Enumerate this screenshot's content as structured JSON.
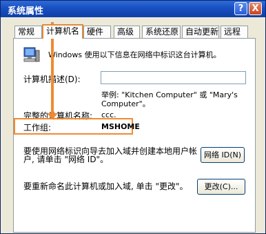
{
  "window": {
    "title": "系统属性",
    "help_button": "?",
    "close_button": "X"
  },
  "tabs": [
    {
      "label": "常规"
    },
    {
      "label": "计算机名",
      "active": true
    },
    {
      "label": "硬件"
    },
    {
      "label": "高级"
    },
    {
      "label": "系统还原"
    },
    {
      "label": "自动更新"
    },
    {
      "label": "远程"
    }
  ],
  "panel": {
    "intro": "Windows 使用以下信息在网络中标识这台计算机。",
    "description_label": "计算机描述(D):",
    "description_value": "",
    "example_line1": "举例: \"Kitchen Computer\" 或 \"Mary's",
    "example_line2": "Computer\"。",
    "full_name_label": "完整的计算机名称:",
    "full_name_value": "ccc.",
    "workgroup_label": "工作组:",
    "workgroup_value": "MSHOME",
    "network_id_text_line1": "要使用网络标识向导去加入域并创建本地用户帐",
    "network_id_text_line2": "户, 请单击 \"网络 ID\"。",
    "network_id_button": "网络 ID(N)",
    "rename_text": "要重新命名此计算机或加入域, 单击 \"更改\"。",
    "change_button": "更改(C)..."
  },
  "colors": {
    "highlight": "#f08a30",
    "titlebar": "#1a4fc0"
  }
}
